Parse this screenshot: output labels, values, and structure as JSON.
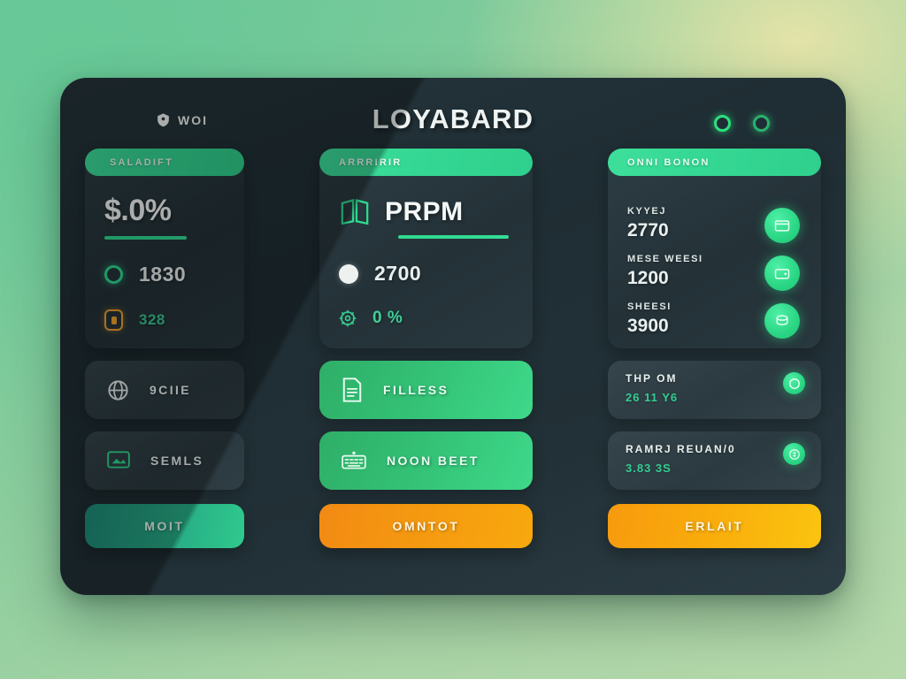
{
  "brand": {
    "mark_icon": "shield-heart-icon",
    "mark_label": "WOI"
  },
  "header": {
    "title": "LOYABARD",
    "icons": [
      {
        "name": "status-ring-icon-1"
      },
      {
        "name": "status-ring-icon-2"
      }
    ]
  },
  "cards": {
    "left": {
      "pill_label": "SALADIFT",
      "primary_value": "$.0%",
      "rows": [
        {
          "icon": "ring-icon",
          "value": "1830"
        },
        {
          "icon": "tag-icon",
          "value": "328"
        }
      ]
    },
    "middle": {
      "pill_label": "ARRRIRIR",
      "primary_value": "PRPM",
      "primary_icon": "book-icon",
      "rows": [
        {
          "icon": "circle-filled-icon",
          "value": "2700"
        },
        {
          "icon": "gear-icon",
          "value": "0 %"
        }
      ]
    },
    "right": {
      "pill_label": "ONNI BONON",
      "stats": [
        {
          "key": "KYYEJ",
          "value": "2770",
          "icon": "card-icon"
        },
        {
          "key": "MESE WEESI",
          "value": "1200",
          "icon": "wallet-icon"
        },
        {
          "key": "SHEESI",
          "value": "3900",
          "icon": "coins-icon"
        }
      ]
    }
  },
  "tiles": {
    "left": [
      {
        "label": "9CIIE",
        "icon": "globe-icon",
        "style": "dark"
      },
      {
        "label": "SEMLS",
        "icon": "monitor-icon",
        "style": "dark"
      }
    ],
    "middle": [
      {
        "label": "FILLESS",
        "icon": "document-icon",
        "style": "green"
      },
      {
        "label": "NOON BEET",
        "icon": "keyboard-icon",
        "style": "green"
      }
    ],
    "right": [
      {
        "key": "THP OM",
        "value": "26 11 Y6",
        "icon": "badge-icon"
      },
      {
        "key": "RAMRJ REUAN/0",
        "value": "3.83 3S",
        "icon": "coin-icon"
      }
    ]
  },
  "buttons": [
    {
      "label": "MOIT",
      "style": "teal"
    },
    {
      "label": "OMNTOT",
      "style": "orange"
    },
    {
      "label": "ERLAIT",
      "style": "amber"
    }
  ],
  "colors": {
    "accent_green": "#2fd98f",
    "accent_orange": "#f59a10",
    "accent_amber": "#fbc410",
    "panel_dark": "#25353b",
    "background_green": "#86cc9c"
  }
}
